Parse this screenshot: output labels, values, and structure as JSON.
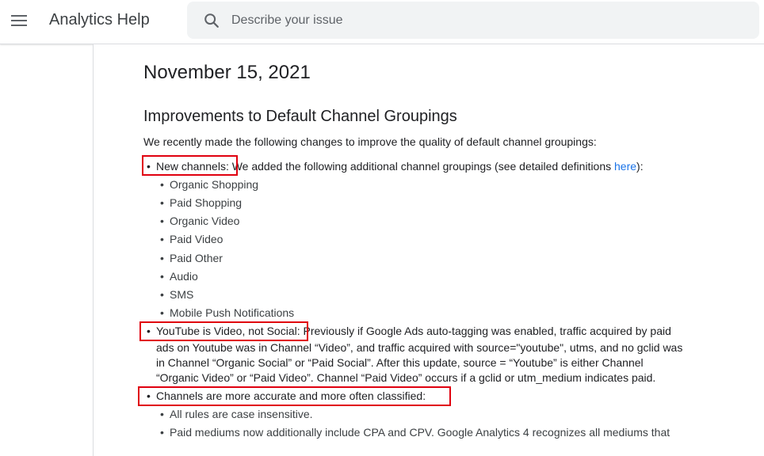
{
  "header": {
    "app_title": "Analytics Help",
    "search_placeholder": "Describe your issue"
  },
  "article": {
    "date": "November 15, 2021",
    "section_title": "Improvements to Default Channel Groupings",
    "intro": "We recently made the following changes to improve the quality of default channel groupings:",
    "bullet1": {
      "label": "New channels:",
      "text_before_link": " We added the following additional channel groupings (see detailed definitions ",
      "link": "here",
      "text_after_link": "):",
      "items": [
        "Organic Shopping",
        "Paid Shopping",
        "Organic Video",
        "Paid Video",
        "Paid Other",
        "Audio",
        "SMS",
        "Mobile Push Notifications"
      ]
    },
    "bullet2": {
      "label": "YouTube is Video, not Social:",
      "lines": [
        "Previously if Google Ads auto-tagging was enabled, traffic acquired by paid",
        "ads on Youtube was in Channel “Video”, and traffic acquired with source=\"youtube\", utms, and no gclid was",
        "in Channel “Organic Social” or “Paid Social”. After this update, source = “Youtube” is either Channel",
        "“Organic Video” or “Paid Video”. Channel “Paid Video” occurs if a gclid or utm_medium indicates paid."
      ]
    },
    "bullet3": {
      "label": "Channels are more accurate and more often classified",
      "label_suffix": ":",
      "items": [
        "All rules are case insensitive.",
        "Paid mediums now additionally include CPA and CPV. Google Analytics 4 recognizes all mediums that"
      ]
    }
  },
  "colors": {
    "highlight": "#e0000f",
    "link": "#1a73e8"
  }
}
